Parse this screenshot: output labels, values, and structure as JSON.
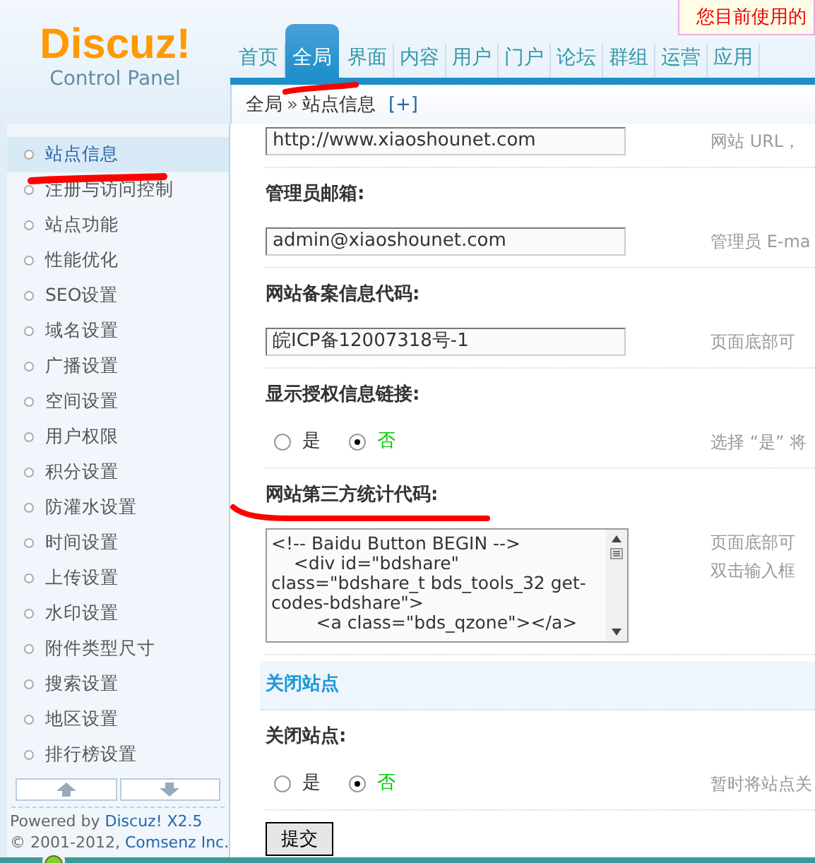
{
  "notice": "您目前使用的",
  "logo": {
    "name": "Discuz!",
    "subtitle": "Control Panel"
  },
  "nav": [
    {
      "label": "首页",
      "selected": false
    },
    {
      "label": "全局",
      "selected": true
    },
    {
      "label": "界面",
      "selected": false
    },
    {
      "label": "内容",
      "selected": false
    },
    {
      "label": "用户",
      "selected": false
    },
    {
      "label": "门户",
      "selected": false
    },
    {
      "label": "论坛",
      "selected": false
    },
    {
      "label": "群组",
      "selected": false
    },
    {
      "label": "运营",
      "selected": false
    },
    {
      "label": "应用",
      "selected": false
    }
  ],
  "breadcrumb": {
    "items": [
      "全局",
      "站点信息"
    ],
    "separator": "»",
    "add": "[+]"
  },
  "sidebar": {
    "items": [
      {
        "label": "站点信息",
        "selected": true
      },
      {
        "label": "注册与访问控制",
        "selected": false
      },
      {
        "label": "站点功能",
        "selected": false
      },
      {
        "label": "性能优化",
        "selected": false
      },
      {
        "label": "SEO设置",
        "selected": false
      },
      {
        "label": "域名设置",
        "selected": false
      },
      {
        "label": "广播设置",
        "selected": false
      },
      {
        "label": "空间设置",
        "selected": false
      },
      {
        "label": "用户权限",
        "selected": false
      },
      {
        "label": "积分设置",
        "selected": false
      },
      {
        "label": "防灌水设置",
        "selected": false
      },
      {
        "label": "时间设置",
        "selected": false
      },
      {
        "label": "上传设置",
        "selected": false
      },
      {
        "label": "水印设置",
        "selected": false
      },
      {
        "label": "附件类型尺寸",
        "selected": false
      },
      {
        "label": "搜索设置",
        "selected": false
      },
      {
        "label": "地区设置",
        "selected": false
      },
      {
        "label": "排行榜设置",
        "selected": false
      }
    ],
    "powered_by": "Powered by",
    "product": "Discuz! X2.5",
    "copyright": "© 2001-2012,",
    "company": "Comsenz Inc."
  },
  "form": {
    "rows": [
      {
        "kind": "input",
        "value": "http://www.xiaoshounet.com",
        "hint": "网站 URL，"
      },
      {
        "kind": "input",
        "label": "管理员邮箱:",
        "value": "admin@xiaoshounet.com",
        "hint": "管理员 E-ma"
      },
      {
        "kind": "input",
        "label": "网站备案信息代码:",
        "value": "皖ICP备12007318号-1",
        "hint": "页面底部可"
      },
      {
        "kind": "radio",
        "label": "显示授权信息链接:",
        "options": [
          {
            "label": "是",
            "selected": false
          },
          {
            "label": "否",
            "selected": true
          }
        ],
        "hint": "选择 “是” 将"
      },
      {
        "kind": "textarea",
        "label": "网站第三方统计代码:",
        "value": "<!-- Baidu Button BEGIN -->\n    <div id=\"bdshare\" class=\"bdshare_t bds_tools_32 get-codes-bdshare\">\n        <a class=\"bds_qzone\"></a>",
        "hints": [
          "页面底部可",
          "双击输入框"
        ]
      },
      {
        "kind": "section",
        "title": "关闭站点"
      },
      {
        "kind": "radio",
        "label": "关闭站点:",
        "options": [
          {
            "label": "是",
            "selected": false
          },
          {
            "label": "否",
            "selected": true
          }
        ],
        "hint": "暂时将站点关"
      }
    ],
    "submit": "提交"
  }
}
